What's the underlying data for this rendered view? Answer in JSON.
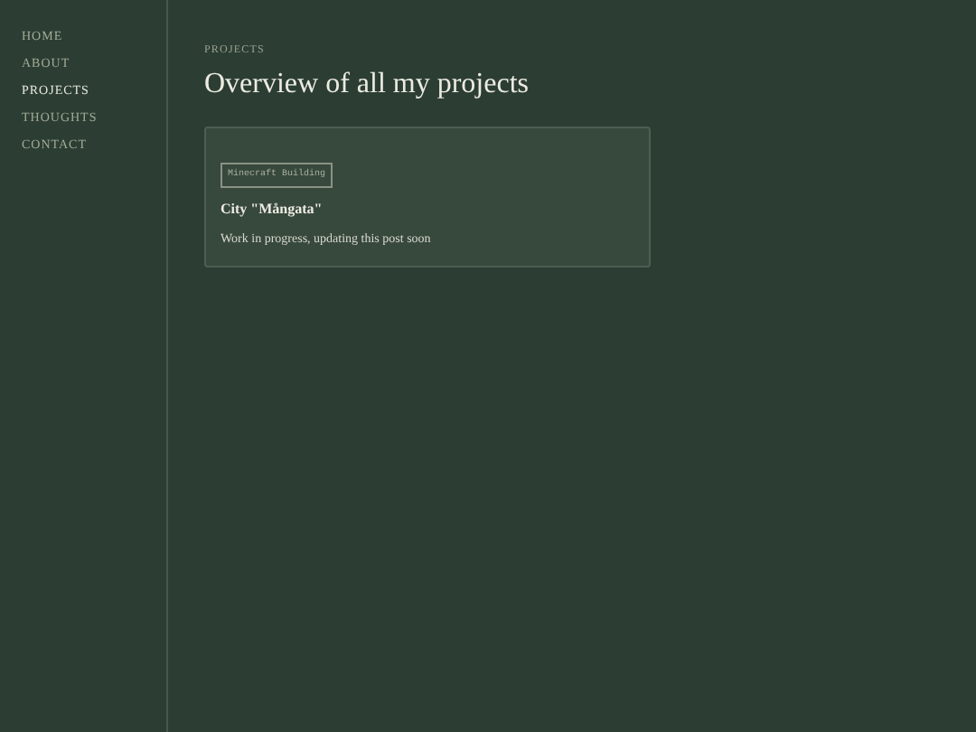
{
  "nav": [
    {
      "label": "HOME",
      "selected": false
    },
    {
      "label": "ABOUT",
      "selected": false
    },
    {
      "label": "PROJECTS",
      "selected": true
    },
    {
      "label": "THOUGHTS",
      "selected": false
    },
    {
      "label": "CONTACT",
      "selected": false
    }
  ],
  "breadcrumb": "PROJECTS",
  "heading": "Overview of all my projects",
  "projects": [
    {
      "tag": "Minecraft Building",
      "title": "City \"Mångata\"",
      "description": "Work in progress, updating this post soon"
    }
  ]
}
